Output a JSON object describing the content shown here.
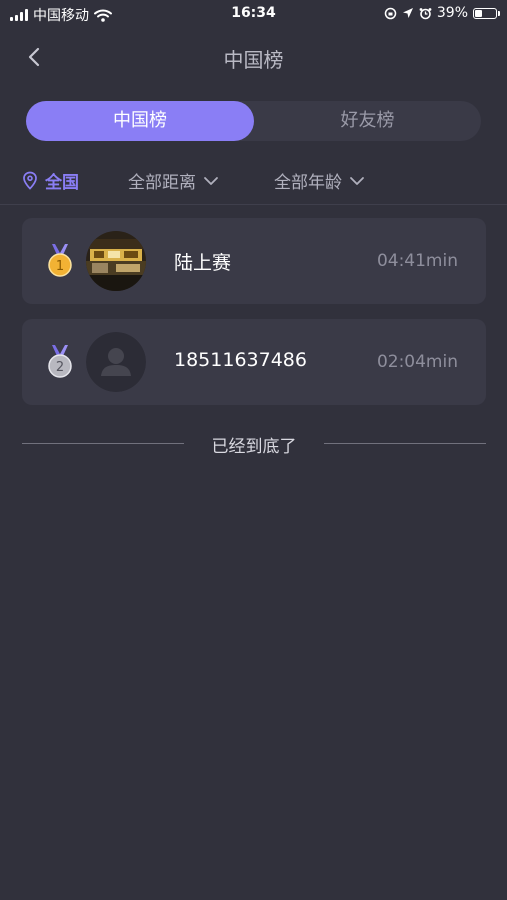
{
  "status_bar": {
    "carrier": "中国移动",
    "time": "16:34",
    "battery": "39%",
    "battery_level": 0.39,
    "icons": [
      "signal-icon",
      "wifi-icon",
      "rotation-lock-icon",
      "location-arrow-icon",
      "alarm-icon",
      "battery-icon"
    ]
  },
  "nav": {
    "title": "中国榜",
    "back_icon": "chevron-left-icon"
  },
  "tabs": [
    {
      "label": "中国榜",
      "active": true
    },
    {
      "label": "好友榜",
      "active": false
    }
  ],
  "filters": {
    "location": "全国",
    "distance": "全部距离",
    "age": "全部年龄"
  },
  "leaderboard": [
    {
      "rank": "1",
      "name": "陆上赛",
      "time": "04:41min",
      "medal": "gold",
      "avatar": "photo"
    },
    {
      "rank": "2",
      "name": "18511637486",
      "time": "02:04min",
      "medal": "silver",
      "avatar": "default-user"
    }
  ],
  "end_text": "已经到底了",
  "colors": {
    "background": "#31313c",
    "card": "#3a3a47",
    "accent": "#8a7ef5",
    "gold": "#f2b234",
    "silver": "#b8b8c0"
  }
}
